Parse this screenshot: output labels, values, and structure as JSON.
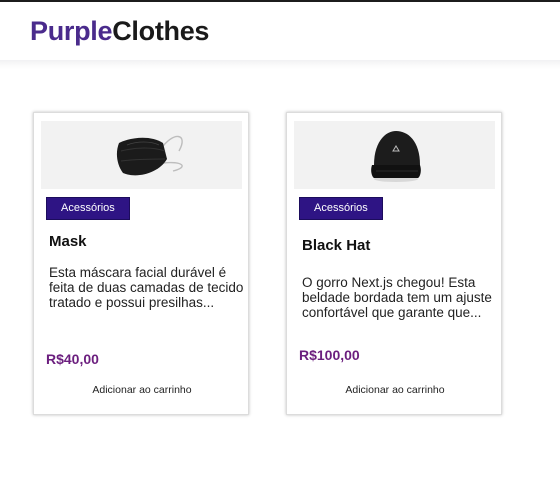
{
  "brand": {
    "part1": "Purple",
    "part2": "Clothes",
    "color1": "#4a2b8c",
    "color2": "#1a1a1a"
  },
  "products": [
    {
      "category": "Acessórios",
      "name": "Mask",
      "description": "Esta máscara facial durável é feita de duas camadas de tecido tratado e possui presilhas...",
      "price": "R$40,00",
      "add_label": "Adicionar ao carrinho",
      "image_icon": "face-mask-icon"
    },
    {
      "category": "Acessórios",
      "name": "Black Hat",
      "description": "O gorro Next.js chegou! Esta beldade bordada tem um ajuste confortável que garante que...",
      "price": "R$100,00",
      "add_label": "Adicionar ao carrinho",
      "image_icon": "beanie-hat-icon"
    }
  ],
  "colors": {
    "badge_bg": "#2e1484",
    "price": "#6b1e7e"
  }
}
